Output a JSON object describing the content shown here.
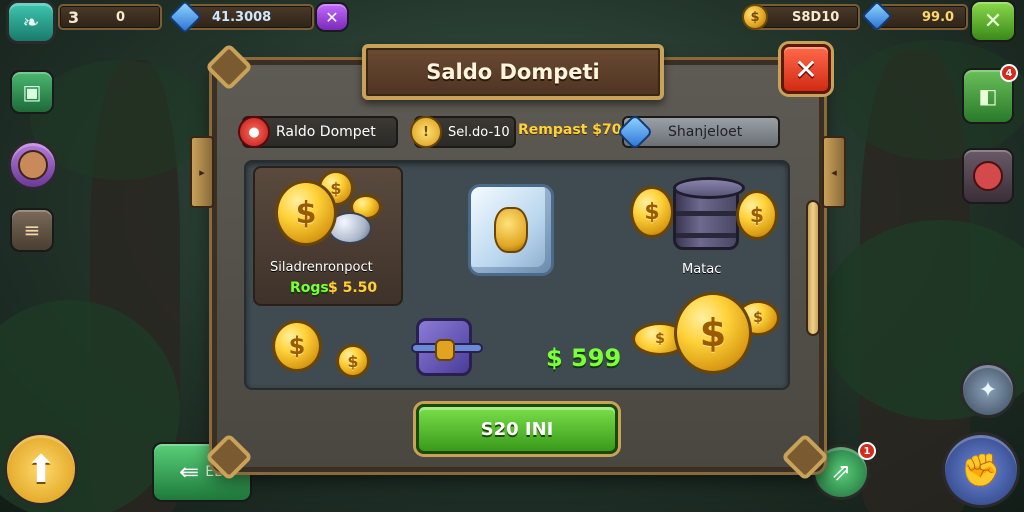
{
  "topbar": {
    "level": "3",
    "coins_left": "0",
    "gems_left": "41.3008",
    "gold_right": "S8D10",
    "gems_right": "99.0"
  },
  "dialog": {
    "title": "Saldo Dompeti",
    "close_label": "✕",
    "tabs": [
      {
        "label": "Raldo Dompet",
        "icon": "pin-icon"
      },
      {
        "label": "Sel.do-10",
        "extra": "Rempast $70",
        "icon": "coin-icon"
      },
      {
        "label": "Shanjeloet",
        "icon": "gem-icon"
      }
    ],
    "items": {
      "card_label": "Siladrenronpoct",
      "card_price_prefix": "Rogs",
      "card_price": "$ 5.50",
      "barrel_label": "Matac",
      "purse_price": "$ 599"
    },
    "buy_button": "S20 INI"
  },
  "badges": {
    "right_top": "4",
    "bottom_right": "1"
  },
  "bottom_left_label": "ED"
}
